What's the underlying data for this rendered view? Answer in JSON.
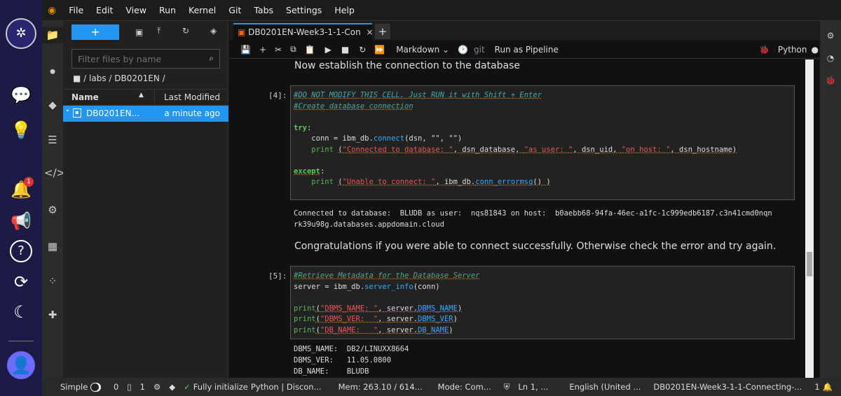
{
  "menu": [
    "File",
    "Edit",
    "View",
    "Run",
    "Kernel",
    "Git",
    "Tabs",
    "Settings",
    "Help"
  ],
  "outer_sidebar": {
    "notification_badge": "1"
  },
  "files": {
    "new_label": "+",
    "filter_placeholder": "Filter files by name",
    "breadcrumb": "/ labs / DB0201EN /",
    "col_name": "Name",
    "col_modified": "Last Modified",
    "items": [
      {
        "name": "DB0201EN...",
        "modified": "a minute ago"
      }
    ]
  },
  "tab": {
    "title": "DB0201EN-Week3-1-1-Con",
    "close": "×",
    "add": "+"
  },
  "toolbar": {
    "cell_type": "Markdown",
    "git": "git",
    "pipeline": "Run as Pipeline",
    "kernel": "Python"
  },
  "notebook": {
    "md1": "Now establish the connection to the database",
    "prompt4": "[4]:",
    "c4": {
      "l1": "#DO NOT MODIFY THIS CELL. Just RUN it with Shift + Enter",
      "l2": "#Create database connection",
      "try": "try",
      "conn": "conn = ibm_db.",
      "connect": "connect",
      "conn_args": "(dsn, \"\", \"\")",
      "print": "print",
      "s1": "\"Connected to database: \"",
      "a1": ", dsn_database, ",
      "s2": "\"as user: \"",
      "a2": ", dsn_uid, ",
      "s3": "\"on host: \"",
      "a3": ", dsn_hostname)",
      "except": "except",
      "s4": "\"Unable to connect: \"",
      "a4": ", ibm_db.",
      "errfn": "conn_errormsg",
      "a5": "() )"
    },
    "out4": "Connected to database:  BLUDB as user:  nqs81843 on host:  b0aebb68-94fa-46ec-a1fc-1c999edb6187.c3n41cmd0nqn\nrk39u98g.databases.appdomain.cloud",
    "md2": "Congratulations if you were able to connect successfully. Otherwise check the error and try again.",
    "prompt5": "[5]:",
    "c5": {
      "l1": "#Retrieve Metadata for the Database Server",
      "l2a": "server = ibm_db.",
      "l2fn": "server_info",
      "l2b": "(conn)",
      "p1s": "\"DBMS_NAME: \"",
      "p1a": ", server.",
      "p1f": "DBMS_NAME",
      "p2s": "\"DBMS_VER:  \"",
      "p2f": "DBMS_VER",
      "p3s": "\"DB_NAME:   \"",
      "p3f": "DB_NAME"
    },
    "out5": "DBMS_NAME:  DB2/LINUXX8664\nDBMS_VER:   11.05.0800\nDB_NAME:    BLUDB"
  },
  "status": {
    "mode": "Simple",
    "n0": "0",
    "n1": "1",
    "kernel_status": "Fully initialize",
    "kernel": "Python | Discon...",
    "mem": "Mem: 263.10 / 614...",
    "cmd_mode": "Mode: Com...",
    "ln": "Ln 1, ...",
    "lang": "English (United ...",
    "file": "DB0201EN-Week3-1-1-Connecting-...",
    "notif": "1"
  }
}
